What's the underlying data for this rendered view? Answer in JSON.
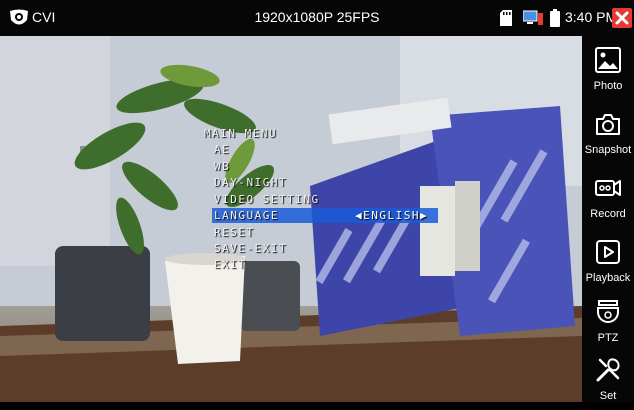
{
  "status_bar": {
    "app_title": "CVI",
    "resolution": "1920x1080P 25FPS",
    "time": "3:40 PM"
  },
  "osd_menu": {
    "title": "MAIN MENU",
    "items": [
      {
        "label": "AE"
      },
      {
        "label": "WB"
      },
      {
        "label": "DAY-NIGHT"
      },
      {
        "label": "VIDEO SETTING"
      },
      {
        "label": "LANGUAGE",
        "selected": true,
        "value": "ENGLISH"
      },
      {
        "label": "RESET"
      },
      {
        "label": "SAVE-EXIT"
      },
      {
        "label": "EXIT"
      }
    ],
    "selected_value_display": "◀ENGLISH▶",
    "highlight_color": "#1a5ad8"
  },
  "toolbar": {
    "tools": [
      {
        "label": "Photo",
        "icon": "image-icon"
      },
      {
        "label": "Snapshot",
        "icon": "camera-icon"
      },
      {
        "label": "Record",
        "icon": "video-icon"
      },
      {
        "label": "Playback",
        "icon": "play-icon"
      },
      {
        "label": "PTZ",
        "icon": "dome-camera-icon"
      },
      {
        "label": "Set",
        "icon": "tools-icon"
      }
    ]
  },
  "colors": {
    "bar_background": "#060606",
    "close_button": "#e53935"
  }
}
